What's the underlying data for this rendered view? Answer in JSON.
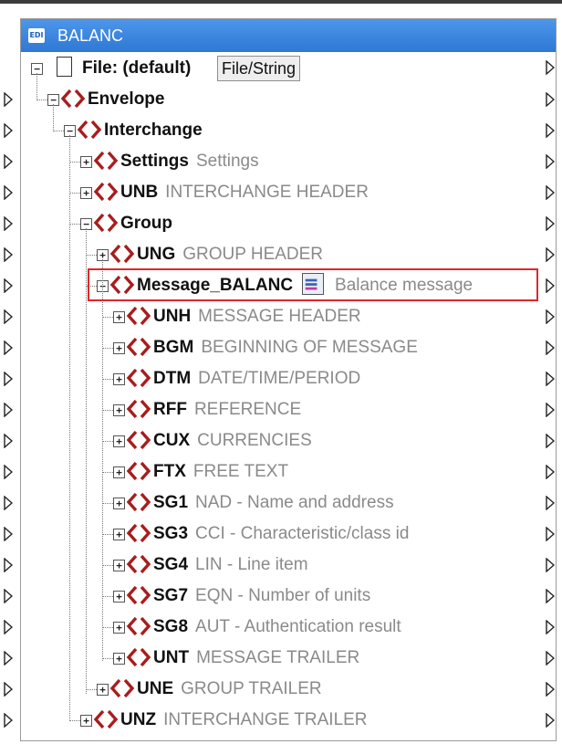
{
  "window": {
    "badge": "EDI",
    "title": "BALANC"
  },
  "file": {
    "label": "File: (default)",
    "button": "File/String"
  },
  "tree": [
    {
      "name": "Envelope",
      "desc": "",
      "expanded": true
    },
    {
      "name": "Interchange",
      "desc": "",
      "expanded": true
    },
    {
      "name": "Settings",
      "desc": "Settings",
      "expanded": false
    },
    {
      "name": "UNB",
      "desc": "INTERCHANGE HEADER",
      "expanded": false
    },
    {
      "name": "Group",
      "desc": "",
      "expanded": true
    },
    {
      "name": "UNG",
      "desc": "GROUP HEADER",
      "expanded": false
    },
    {
      "name": "Message_BALANC",
      "desc": "Balance message",
      "expanded": true,
      "selected": true
    },
    {
      "name": "UNH",
      "desc": "MESSAGE HEADER",
      "expanded": false
    },
    {
      "name": "BGM",
      "desc": "BEGINNING OF MESSAGE",
      "expanded": false
    },
    {
      "name": "DTM",
      "desc": "DATE/TIME/PERIOD",
      "expanded": false
    },
    {
      "name": "RFF",
      "desc": "REFERENCE",
      "expanded": false
    },
    {
      "name": "CUX",
      "desc": "CURRENCIES",
      "expanded": false
    },
    {
      "name": "FTX",
      "desc": "FREE TEXT",
      "expanded": false
    },
    {
      "name": "SG1",
      "desc": "NAD - Name and address",
      "expanded": false
    },
    {
      "name": "SG3",
      "desc": "CCI - Characteristic/class id",
      "expanded": false
    },
    {
      "name": "SG4",
      "desc": "LIN - Line item",
      "expanded": false
    },
    {
      "name": "SG7",
      "desc": "EQN - Number of units",
      "expanded": false
    },
    {
      "name": "SG8",
      "desc": "AUT - Authentication result",
      "expanded": false
    },
    {
      "name": "UNT",
      "desc": "MESSAGE TRAILER",
      "expanded": false
    },
    {
      "name": "UNE",
      "desc": "GROUP TRAILER",
      "expanded": false
    },
    {
      "name": "UNZ",
      "desc": "INTERCHANGE TRAILER",
      "expanded": false
    }
  ],
  "colors": {
    "tag": "#a81d1d",
    "highlight": "#e0262b",
    "titlebar": "#3a86e0"
  }
}
